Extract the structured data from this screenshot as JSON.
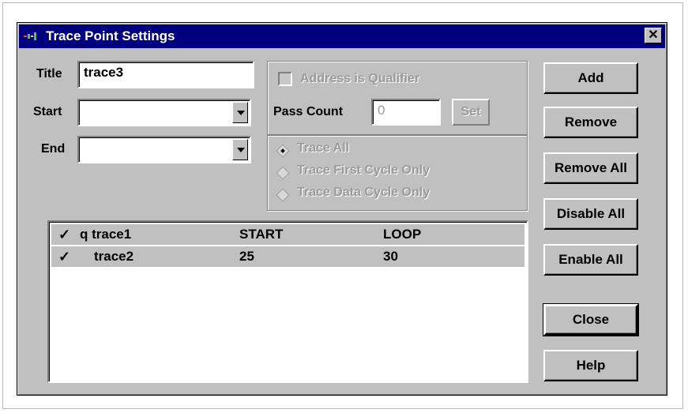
{
  "window": {
    "title": "Trace Point Settings",
    "close_glyph": "✕"
  },
  "form": {
    "title_label": "Title",
    "title_value": "trace3",
    "start_label": "Start",
    "start_value": "",
    "end_label": "End",
    "end_value": ""
  },
  "qualifier": {
    "address_label": "Address is Qualifier",
    "pass_count_label": "Pass Count",
    "pass_count_value": "0",
    "set_label": "Set"
  },
  "trace_mode": {
    "options": [
      "Trace All",
      "Trace First Cycle Only",
      "Trace Data Cycle Only"
    ],
    "selected": "Trace All"
  },
  "trace_list": {
    "rows": [
      {
        "checked": true,
        "name": "q trace1",
        "start": "START",
        "end": "LOOP"
      },
      {
        "checked": true,
        "name": "trace2",
        "start": "25",
        "end": "30"
      }
    ]
  },
  "buttons": {
    "add": "Add",
    "remove": "Remove",
    "remove_all": "Remove All",
    "disable_all": "Disable All",
    "enable_all": "Enable All",
    "close": "Close",
    "help": "Help"
  },
  "colors": {
    "titlebar": "#00007f",
    "face": "#c0c0c0"
  }
}
